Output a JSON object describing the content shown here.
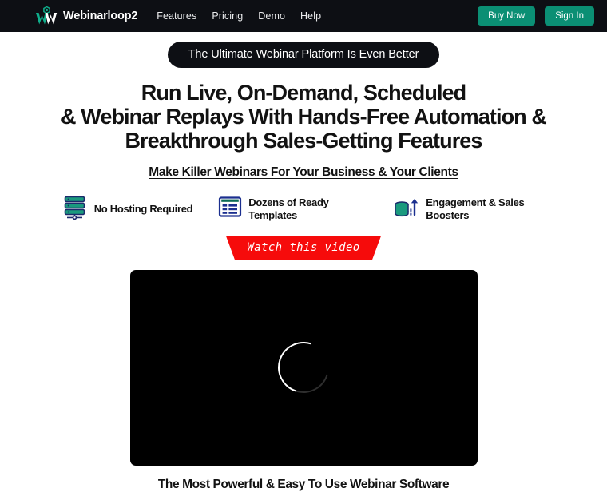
{
  "header": {
    "brand_name": "Webinarloop2",
    "logo_icon": "webinarloop-w-logo",
    "nav": [
      {
        "label": "Features"
      },
      {
        "label": "Pricing"
      },
      {
        "label": "Demo"
      },
      {
        "label": "Help"
      }
    ],
    "buy_now_label": "Buy Now",
    "sign_in_label": "Sign In",
    "background_color": "#0d0f14",
    "button_color": "#0b8f74"
  },
  "hero": {
    "pill_text": "The Ultimate Webinar Platform Is Even Better",
    "headline_lines": [
      "Run Live, On-Demand, Scheduled",
      "& Webinar Replays With Hands-Free Automation &",
      "Breakthrough Sales-Getting Features"
    ],
    "subheadline": "Make Killer Webinars For Your Business & Your Clients",
    "features": [
      {
        "icon": "server-rack-icon",
        "label": "No Hosting Required"
      },
      {
        "icon": "template-window-icon",
        "label": "Dozens of Ready Templates"
      },
      {
        "icon": "database-growth-arrow-icon",
        "label": "Engagement & Sales Boosters"
      }
    ],
    "ribbon_text": "Watch this video",
    "ribbon_color": "#f60b0b"
  },
  "video": {
    "state_icon": "loading-spinner-icon",
    "background_color": "#000000"
  },
  "footer": {
    "tagline": "The Most Powerful & Easy To Use Webinar Software"
  }
}
